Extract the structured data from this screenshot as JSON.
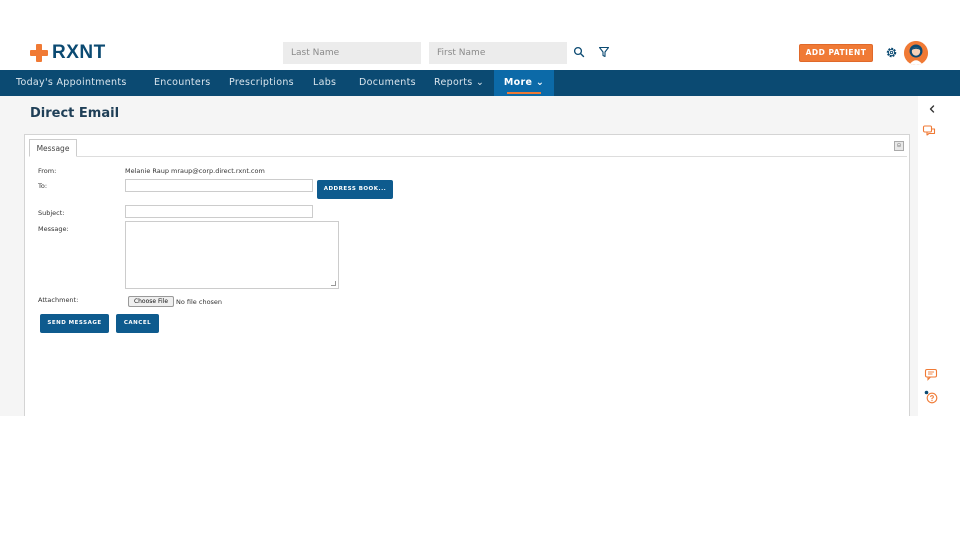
{
  "app": {
    "brand": "RXNT"
  },
  "header": {
    "last_name_placeholder": "Last Name",
    "first_name_placeholder": "First Name",
    "add_patient_label": "ADD PATIENT",
    "accent_color": "#f07a35"
  },
  "nav": {
    "items": [
      {
        "label": "Today's Appointments"
      },
      {
        "label": "Encounters"
      },
      {
        "label": "Prescriptions"
      },
      {
        "label": "Labs"
      },
      {
        "label": "Documents"
      },
      {
        "label": "Reports ⌄"
      },
      {
        "label": "More ⌄",
        "active": true
      }
    ],
    "bg_color": "#0b4a72",
    "active_color": "#0c6aa8"
  },
  "page": {
    "title": "Direct Email"
  },
  "form": {
    "tab_label": "Message",
    "from_label": "From:",
    "from_value": "Melanie Raup mraup@corp.direct.rxnt.com",
    "to_label": "To:",
    "to_value": "",
    "address_book_label": "ADDRESS BOOK...",
    "subject_label": "Subject:",
    "subject_value": "",
    "message_label": "Message:",
    "message_value": "",
    "attachment_label": "Attachment:",
    "choose_file_label": "Choose File",
    "no_file_label": "No file chosen",
    "send_label": "SEND MESSAGE",
    "cancel_label": "CANCEL"
  },
  "icons": {
    "header": [
      "search-icon",
      "filter-icon",
      "gear-icon",
      "avatar"
    ],
    "rail": [
      "chevron-left-icon",
      "chat-bubbles-icon",
      "message-icon",
      "help-icon"
    ]
  }
}
